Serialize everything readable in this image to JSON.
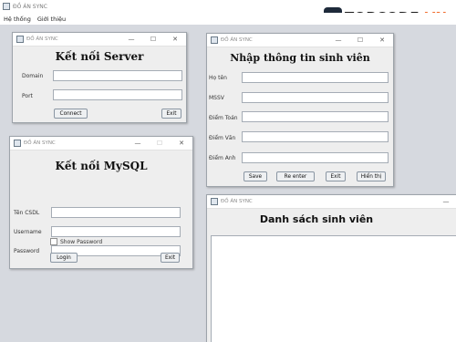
{
  "app": {
    "title": "ĐỒ ÁN SYNC",
    "menu": [
      "Hệ thống",
      "Giới thiệu"
    ]
  },
  "watermark": {
    "badge": "{}",
    "text_brand": "TOPCODE",
    "text_suffix": ".VN",
    "accent_color": "#f26b2b"
  },
  "window_controls": {
    "minimize": "—",
    "maximize": "☐",
    "close": "✕"
  },
  "server_window": {
    "title": "ĐỒ ÁN SYNC",
    "heading": "Kết nối Server",
    "domain_label": "Domain",
    "domain_value": "",
    "port_label": "Port",
    "port_value": "",
    "connect_button": "Connect",
    "exit_button": "Exit"
  },
  "mysql_window": {
    "title": "ĐỒ ÁN SYNC",
    "heading": "Kết nối MySQL",
    "db_name_label": "Tên CSDL",
    "username_label": "Username",
    "password_label": "Password",
    "show_password_label": "Show Password",
    "show_password_checked": false,
    "login_button": "Login",
    "exit_button": "Exit"
  },
  "student_input_window": {
    "title": "ĐỒ ÁN SYNC",
    "heading": "Nhập thông tin sinh viên",
    "name_label": "Họ tên",
    "id_label": "MSSV",
    "math_label": "Điểm Toán",
    "literature_label": "Điểm Văn",
    "english_label": "Điểm Anh",
    "save_button": "Save",
    "reenter_button": "Re enter",
    "exit_button": "Exit",
    "show_button": "Hiển thị"
  },
  "student_list_window": {
    "title": "ĐỒ ÁN SYNC",
    "heading": "Danh sách sinh viên",
    "rows": []
  }
}
